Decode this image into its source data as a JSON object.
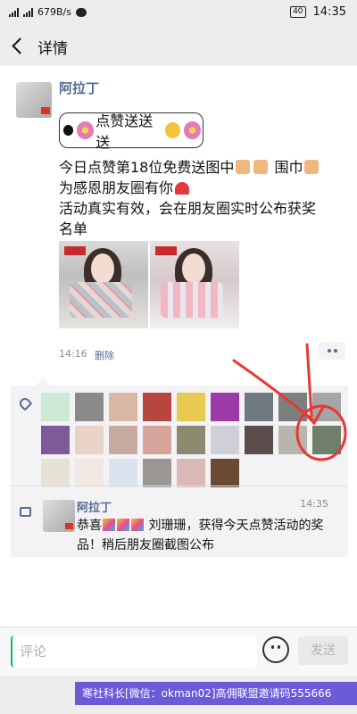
{
  "status_bar": {
    "network_speed": "679B/s",
    "battery": "40",
    "time": "14:35"
  },
  "header": {
    "title": "详情"
  },
  "post": {
    "author": "阿拉丁",
    "badge_text": "点赞送送送",
    "lines": [
      "今日点赞第18位免费送图中",
      "围巾",
      "为感恩朋友圈有你",
      "活动真实有效，会在朋友圈实时公布获奖",
      "名单"
    ],
    "time": "14:16",
    "delete_label": "删除"
  },
  "comment": {
    "author": "阿拉丁",
    "time": "14:35",
    "text_prefix": "恭喜",
    "text_main": "刘珊珊，获得今天点赞活动的奖品！稍后朋友圈截图公布"
  },
  "input_bar": {
    "placeholder": "评论",
    "send_label": "发送"
  },
  "banner": {
    "text": "寒社科长[微信：okman02]高佣联盟邀请码555666"
  },
  "colors": {
    "link": "#576b95",
    "annotation": "#e53935",
    "banner": "#6b5bd8",
    "accent_green": "#07c160"
  },
  "icons": [
    "back-arrow-icon",
    "heart-icon",
    "comment-icon",
    "smile-icon",
    "more-dots-icon"
  ]
}
